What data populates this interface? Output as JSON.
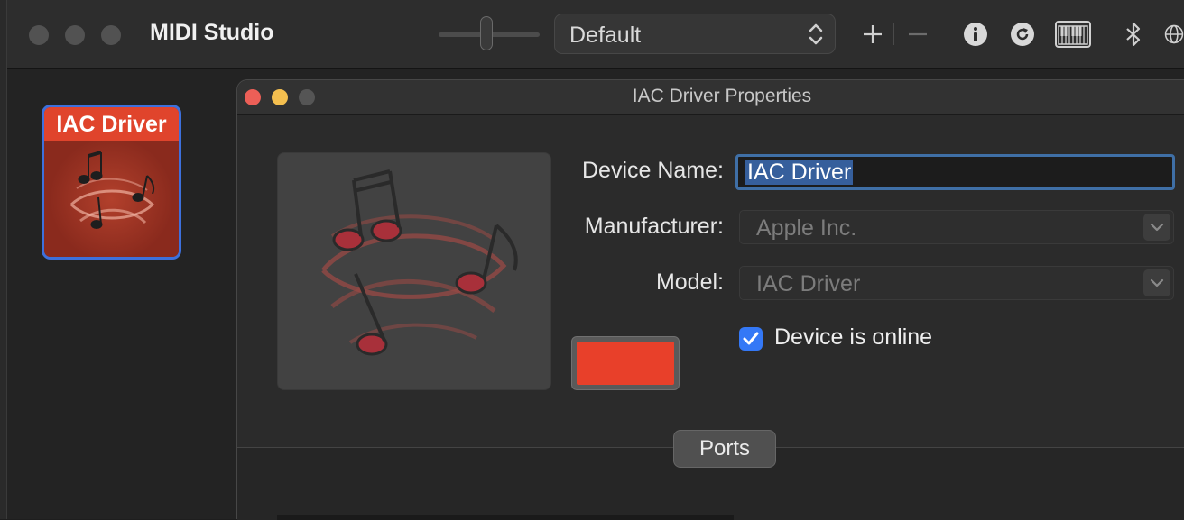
{
  "window": {
    "title": "MIDI Studio"
  },
  "toolbar": {
    "configuration_value": "Default",
    "icons": [
      "add-icon",
      "remove-icon",
      "info-icon",
      "rescan-icon",
      "keyboard-icon",
      "bluetooth-icon",
      "network-icon"
    ]
  },
  "device_list": {
    "items": [
      {
        "label": "IAC Driver",
        "selected": true
      }
    ]
  },
  "properties": {
    "title": "IAC Driver Properties",
    "device_name_label": "Device Name:",
    "device_name_value": "IAC Driver",
    "manufacturer_label": "Manufacturer:",
    "manufacturer_value": "Apple Inc.",
    "model_label": "Model:",
    "model_value": "IAC Driver",
    "online_label": "Device is online",
    "online_checked": true,
    "device_color": "#e8402a",
    "ports_tab_label": "Ports"
  },
  "colors": {
    "accent": "#3478f6",
    "selection": "#3d70dc",
    "close": "#ec5f57",
    "minimize": "#f4bf4f",
    "device_label_bg": "#e0442c"
  }
}
